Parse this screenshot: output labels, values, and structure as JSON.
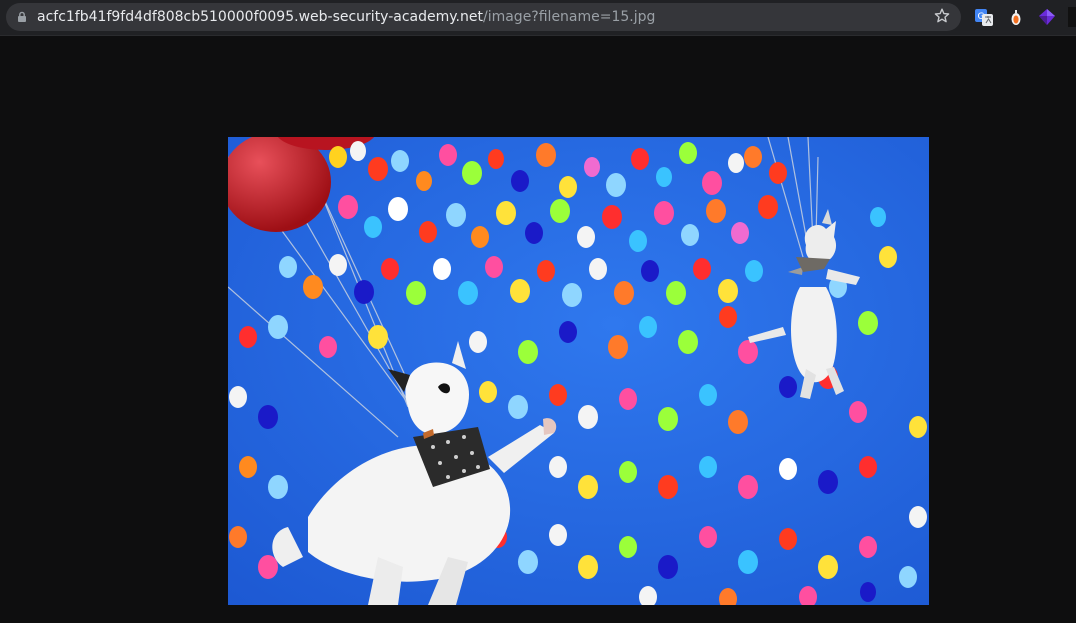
{
  "browser": {
    "url_host": "acfc1fb41f9fd4df808cb510000f0095.web-security-academy.net",
    "url_path": "/image?filename=15.jpg",
    "icons": [
      "lock-icon",
      "bookmark-star-icon",
      "translate-extension-icon",
      "pepper-extension-icon",
      "gem-extension-icon"
    ]
  },
  "content": {
    "image_subject": "dogs-floating-with-balloons",
    "image_colors": {
      "sky": "#1f63dc",
      "red_balloon": "#c0141c"
    }
  }
}
